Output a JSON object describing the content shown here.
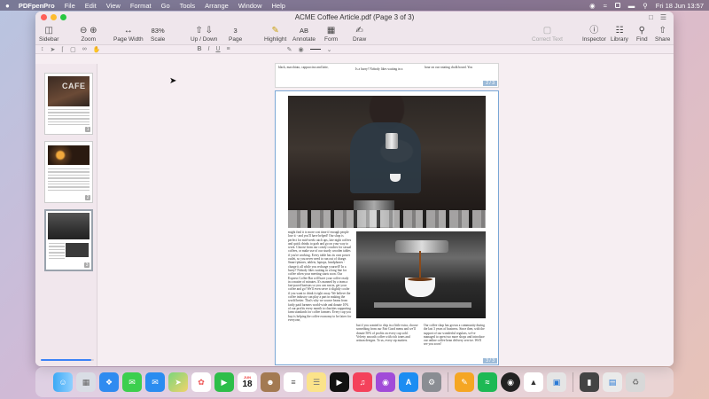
{
  "menubar": {
    "apple": "",
    "items": [
      "PDFpenPro",
      "File",
      "Edit",
      "View",
      "Format",
      "Go",
      "Tools",
      "Arrange",
      "Window",
      "Help"
    ],
    "clock": "Fri 18 Jun  13:57"
  },
  "window": {
    "title": "ACME Coffee Article.pdf (Page 3 of 3)"
  },
  "toolbar": {
    "sidebar": "Sidebar",
    "zoom": "Zoom",
    "page_width": "Page Width",
    "scale_value": "83%",
    "scale": "Scale",
    "up_down": "Up / Down",
    "page_value": "3",
    "page": "Page",
    "highlight": "Highlight",
    "annotate_value": "AB",
    "annotate": "Annotate",
    "form": "Form",
    "draw": "Draw",
    "correct_text": "Correct Text",
    "inspector": "Inspector",
    "library": "Library",
    "find": "Find",
    "share": "Share"
  },
  "sidebar": {
    "thumbs": [
      {
        "num": "1",
        "cover_text": "CAFE"
      },
      {
        "num": "2"
      },
      {
        "num": "3"
      }
    ],
    "progress": 0.95
  },
  "pages": {
    "prev": {
      "col1": "black, macchiato, cappuccino and latte,",
      "col2": "Is a hurry? Nobody likes waiting in a",
      "col3": "hour on our rotating chalk board. You",
      "tag": "2 / 3"
    },
    "current": {
      "tag": "3 / 3",
      "col1": "might find it is more cost time if enough people lose it - and you'll have helped! Our shop is perfect for mid-week catch ups, late night coffees and quick drinks to grab and go on your way to work. Choose from our comfy couches for casual coffees, or make use of our sturdy wooden tables if you're working. Every table has its own power outlet, so you never need to run out of charge. Smart-phones, tablets, laptops, headphones - charge it all while you recharge yourself! In a hurry? Nobody likes waiting in a long line for coffee when your meeting starts soon. Our Express Coffee Bar will have your coffee ready in a matter of minutes. It's manned by a team a fast-paced baristas so you can run in, get your coffee and go! We'll even serve it slightly cooler if you want to drink it right away. We believe the coffee industry can play a part in making the world better. That's why we source beans from fairly paid farmers world-wide and donate 10% of our profits every month to charities supporting farm standards for coffee farmers. Every cup you buy is helping the coffee economy to be fairer for everyone,",
      "col2": "but if you wanted to chip in a little extra, choose something from our Fair Good menu and we'll donate 50% of profits on every cup sold. Velvety smooth coffee with rich tones and artisan designs. To us, every sip matters.",
      "col3": "Our coffee shop has grown a community during the last 3 years of business. Since then, with the support of our wonderful regulars, we've managed to open two more shops and introduce our online coffee bean delivery service. We'll see you soon!"
    }
  },
  "dock": {
    "calendar_month": "JUN",
    "calendar_day": "18",
    "apps": [
      "finder-icon",
      "launchpad-icon",
      "safari-icon",
      "messages-icon",
      "mail-icon",
      "maps-icon",
      "photos-icon",
      "facetime-icon",
      "calendar-icon",
      "contacts-icon",
      "reminders-icon",
      "notes-icon",
      "tv-icon",
      "music-icon",
      "podcasts-icon",
      "appstore-icon",
      "settings-icon",
      "pdfpen-icon",
      "spotify-icon",
      "obs-icon",
      "vpn-icon",
      "preview-icon",
      "scanner-icon",
      "files-icon",
      "trash-icon"
    ]
  }
}
